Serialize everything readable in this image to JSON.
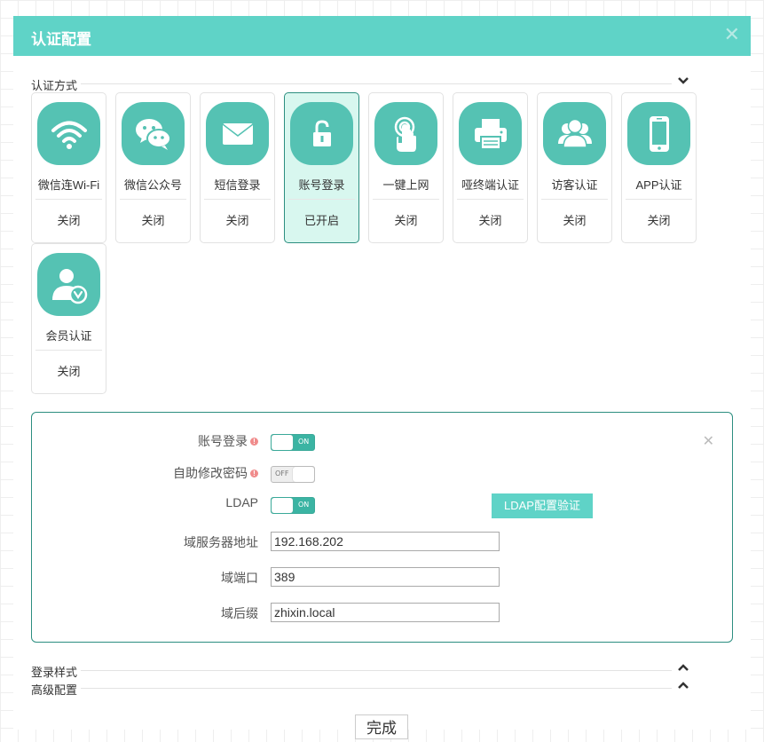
{
  "dialog": {
    "title": "认证配置",
    "close_icon": "close-icon"
  },
  "sections": {
    "auth_method": "认证方式",
    "login_style": "登录样式",
    "advanced": "高级配置"
  },
  "methods": [
    {
      "name": "微信连Wi-Fi",
      "status": "关闭",
      "icon": "wifi-icon",
      "active": false
    },
    {
      "name": "微信公众号",
      "status": "关闭",
      "icon": "wechat-icon",
      "active": false
    },
    {
      "name": "短信登录",
      "status": "关闭",
      "icon": "envelope-icon",
      "active": false
    },
    {
      "name": "账号登录",
      "status": "已开启",
      "icon": "lock-icon",
      "active": true
    },
    {
      "name": "一键上网",
      "status": "关闭",
      "icon": "tap-icon",
      "active": false
    },
    {
      "name": "哑终端认证",
      "status": "关闭",
      "icon": "printer-icon",
      "active": false
    },
    {
      "name": "访客认证",
      "status": "关闭",
      "icon": "users-icon",
      "active": false
    },
    {
      "name": "APP认证",
      "status": "关闭",
      "icon": "phone-icon",
      "active": false
    },
    {
      "name": "会员认证",
      "status": "关闭",
      "icon": "member-icon",
      "active": false
    }
  ],
  "panel": {
    "account_login_label": "账号登录",
    "self_change_pwd_label": "自助修改密码",
    "ldap_label": "LDAP",
    "ldap_button": "LDAP配置验证",
    "domain_server_label": "域服务器地址",
    "domain_server_value": "192.168.202",
    "domain_port_label": "域端口",
    "domain_port_value": "389",
    "domain_suffix_label": "域后缀",
    "domain_suffix_value": "zhixin.local",
    "toggle_on_text": "ON",
    "toggle_off_text": "OFF",
    "info_mark": "!"
  },
  "footer": {
    "done_label": "完成"
  },
  "colors": {
    "header": "#5fd3c7",
    "icon_bg": "#55c2b3",
    "active_card_bg": "#d8f7ef",
    "active_border": "#2c8e80"
  }
}
